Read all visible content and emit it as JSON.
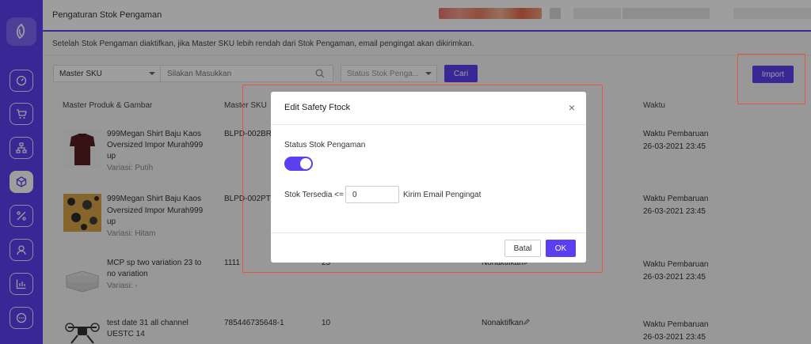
{
  "header": {
    "title": "Pengaturan Stok Pengaman"
  },
  "notice": "Setelah Stok Pengaman diaktifkan, jika Master SKU lebih rendah dari Stok Pengaman, email pengingat akan dikirimkan.",
  "filters": {
    "master_sku_select": "Master SKU",
    "search_placeholder": "Silakan Masukkan",
    "status_select": "Status Stok Penga...",
    "search_button": "Cari"
  },
  "import_button": "Import",
  "table": {
    "headers": [
      "Master Produk & Gambar",
      "Master SKU",
      "Waktu"
    ],
    "rows": [
      {
        "name_line1": "999Megan Shirt Baju Kaos",
        "name_line2": "Oversized Impor Murah999",
        "name_line3": "up",
        "variant": "Variasi: Putih",
        "sku": "BLPD-002BR",
        "time_label": "Waktu Pembaruan",
        "time": "26-03-2021 23:45"
      },
      {
        "name_line1": "999Megan Shirt Baju Kaos",
        "name_line2": "Oversized Impor Murah999",
        "name_line3": "up",
        "variant": "Variasi: Hitam",
        "sku": "BLPD-002PT",
        "time_label": "Waktu Pembaruan",
        "time": "26-03-2021 23:45"
      },
      {
        "name_line1": "MCP sp two variation 23 to",
        "name_line2": "no variation",
        "variant": "Variasi: -",
        "sku": "1111",
        "stock": "23",
        "status": "Nonaktifkan",
        "time_label": "Waktu Pembaruan",
        "time": "26-03-2021 23:45"
      },
      {
        "name_line1": "test date 31 all channel",
        "name_line2": "UESTC 14",
        "sku": "785446735648-1",
        "stock": "10",
        "status": "Nonaktifkan",
        "time_label": "Waktu Pembaruan",
        "time": "26-03-2021 23:45"
      }
    ]
  },
  "modal": {
    "title": "Edit Safety Ftock",
    "status_label": "Status Stok Pengaman",
    "stock_label": "Stok Tersedia <=",
    "stock_value": "0",
    "email_label": "Kirim Email Pengingat",
    "cancel_button": "Batal",
    "ok_button": "OK"
  },
  "colors": {
    "primary": "#5b3ff0",
    "highlight": "#e8543a"
  },
  "icons": [
    "logo-icon",
    "dashboard-icon",
    "cart-icon",
    "sitemap-icon",
    "box-icon",
    "percent-icon",
    "user-icon",
    "chart-icon",
    "chat-icon",
    "edit-icon",
    "close-icon",
    "search-icon"
  ]
}
